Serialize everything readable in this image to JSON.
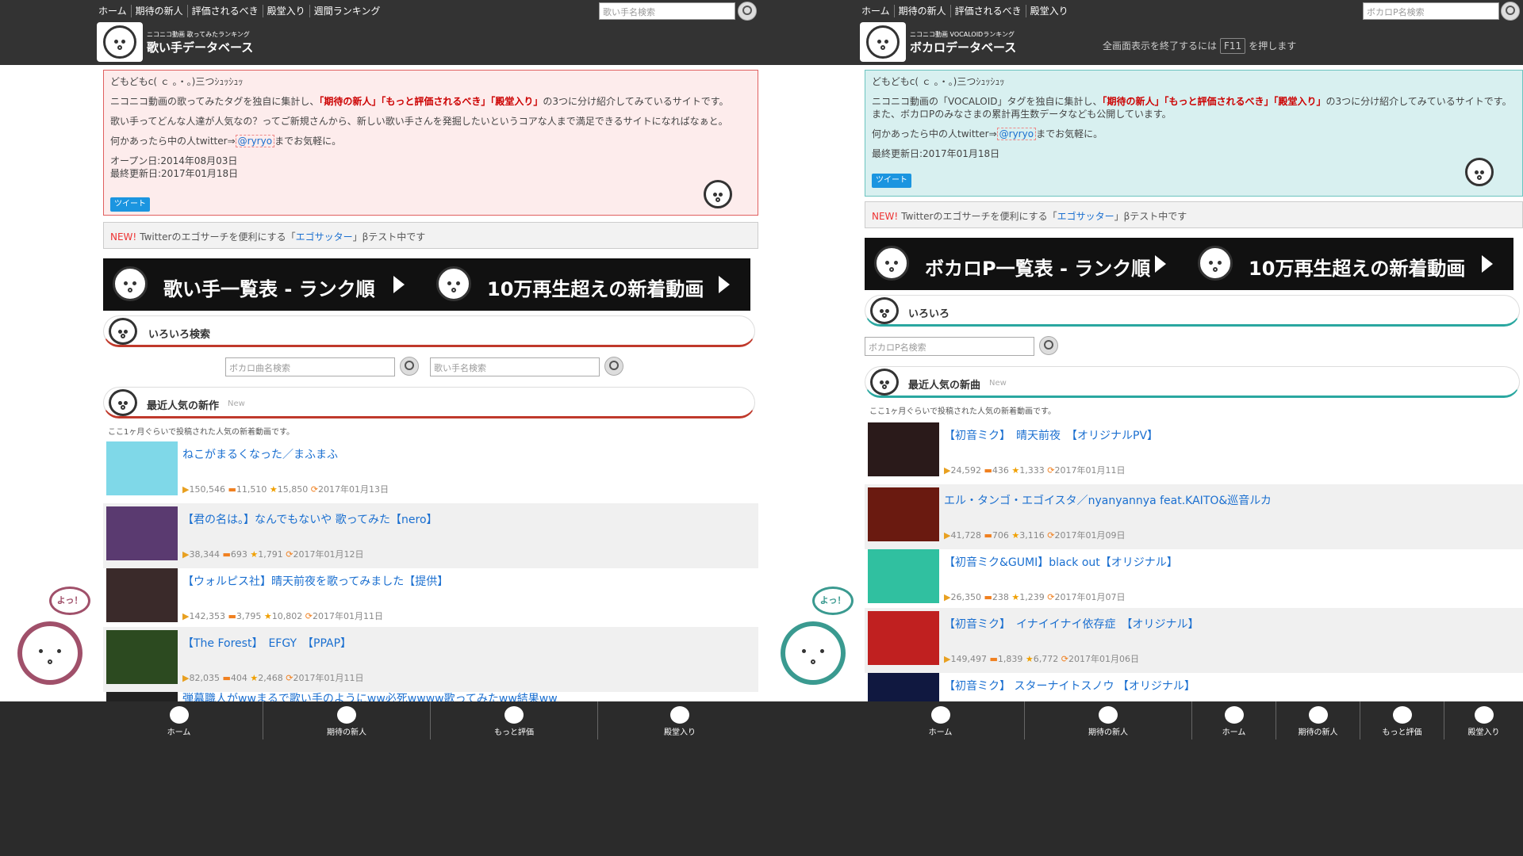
{
  "left": {
    "nav": [
      "ホーム",
      "期待の新人",
      "評価されるべき",
      "殿堂入り",
      "週間ランキング"
    ],
    "search_placeholder": "歌い手名検索",
    "logo_sub": "ニコニコ動画 歌ってみたランキング",
    "logo_title": "歌い手データベース",
    "intro": {
      "greeting": "どもどもc( ｃ ｡・。)三つｼｭｯｼｭｯ",
      "line1_pre": "ニコニコ動画の歌ってみたタグを独自に集計し、",
      "line1_hl": "「期待の新人」「もっと評価されるべき」「殿堂入り」",
      "line1_post": "の3つに分け紹介してみているサイトです。",
      "line2": "歌い手ってどんな人達が人気なの？ってご新規さんから、新しい歌い手さんを発掘したいというコアな人まで満足できるサイトになればなぁと。",
      "contact_pre": "何かあったら中の人twitter⇒",
      "contact_link": "@ryryo",
      "contact_post": "までお気軽に。",
      "open_date": "オープン日:2014年08月03日",
      "updated": "最終更新日:2017年01月18日",
      "tweet": "ツイート"
    },
    "newbar": {
      "new": "NEW!",
      "pre": "Twitterのエゴサーチを便利にする「",
      "link": "エゴサッター",
      "post": "」βテスト中です"
    },
    "banner": {
      "item1": "歌い手一覧表 - ランク順",
      "item2": "10万再生超えの新着動画"
    },
    "section_search": "いろいろ検索",
    "search1": "ボカロ曲名検索",
    "search2": "歌い手名検索",
    "section_recent": "最近人気の新作",
    "new_tag": "New",
    "note": "ここ1ヶ月ぐらいで投稿された人気の新着動画です。",
    "items": [
      {
        "title": "ねこがまるくなった／まふまふ",
        "views": "150,546",
        "comments": "11,510",
        "mylist": "15,850",
        "date": "2017年01月13日",
        "thumb": "#7fd8e8"
      },
      {
        "title": "【君の名は。】なんでもないや 歌ってみた【nero】",
        "views": "38,344",
        "comments": "693",
        "mylist": "1,791",
        "date": "2017年01月12日",
        "thumb": "#5a3a70"
      },
      {
        "title": "【ウォルピス社】晴天前夜を歌ってみました【提供】",
        "views": "142,353",
        "comments": "3,795",
        "mylist": "10,802",
        "date": "2017年01月11日",
        "thumb": "#3a2a2a"
      },
      {
        "title": "【The Forest】　EFGY　【PPAP】",
        "views": "82,035",
        "comments": "404",
        "mylist": "2,468",
        "date": "2017年01月11日",
        "thumb": "#2c4a20"
      },
      {
        "title": "弾幕職人がwwまるで歌い手のようにww必死wwww歌ってみたww結果ww",
        "views": "",
        "comments": "",
        "mylist": "",
        "date": "",
        "thumb": "#222"
      }
    ],
    "tabs": [
      "ホーム",
      "期待の新人",
      "もっと評価",
      "殿堂入り"
    ],
    "yo": "よっ！",
    "accent": "#c0392b",
    "mascot_color": "#a0506a"
  },
  "right": {
    "nav": [
      "ホーム",
      "期待の新人",
      "評価されるべき",
      "殿堂入り"
    ],
    "search_placeholder": "ボカロP名検索",
    "logo_sub": "ニコニコ動画 VOCALOIDランキング",
    "logo_title": "ボカロデータベース",
    "fs_pre": "全画面表示を終了するには",
    "fs_key": "F11",
    "fs_post": "を押します",
    "intro": {
      "greeting": "どもどもc( ｃ ｡・。)三つｼｭｯｼｭｯ",
      "line1_pre": "ニコニコ動画の「VOCALOID」タグを独自に集計し、",
      "line1_hl": "「期待の新人」「もっと評価されるべき」「殿堂入り」",
      "line1_post": "の3つに分け紹介してみているサイトです。また、ボカロPのみなさまの累計再生数データなども公開しています。",
      "contact_pre": "何かあったら中の人twitter⇒",
      "contact_link": "@ryryo",
      "contact_post": "までお気軽に。",
      "updated": "最終更新日:2017年01月18日",
      "tweet": "ツイート"
    },
    "newbar": {
      "new": "NEW!",
      "pre": "Twitterのエゴサーチを便利にする「",
      "link": "エゴサッター",
      "post": "」βテスト中です"
    },
    "banner": {
      "item1": "ボカロP一覧表 - ランク順",
      "item2": "10万再生超えの新着動画"
    },
    "section_misc": "いろいろ",
    "search1": "ボカロP名検索",
    "section_recent": "最近人気の新曲",
    "new_tag": "New",
    "note": "ここ1ヶ月ぐらいで投稿された人気の新着動画です。",
    "items": [
      {
        "title": "【初音ミク】　晴天前夜　【オリジナルPV】",
        "views": "24,592",
        "comments": "436",
        "mylist": "1,333",
        "date": "2017年01月11日",
        "thumb": "#2a1a1a"
      },
      {
        "title": "エル・タンゴ・エゴイスタ／nyanyannya feat.KAITO&巡音ルカ",
        "views": "41,728",
        "comments": "706",
        "mylist": "3,116",
        "date": "2017年01月09日",
        "thumb": "#6a1a10"
      },
      {
        "title": "【初音ミク&GUMI】black out【オリジナル】",
        "views": "26,350",
        "comments": "238",
        "mylist": "1,239",
        "date": "2017年01月07日",
        "thumb": "#30c0a0"
      },
      {
        "title": "【初音ミク】　イナイイナイ依存症　【オリジナル】",
        "views": "149,497",
        "comments": "1,839",
        "mylist": "6,772",
        "date": "2017年01月06日",
        "thumb": "#c02020"
      },
      {
        "title": "【初音ミク】 スターナイトスノウ 【オリジナル】",
        "views": "",
        "comments": "",
        "mylist": "",
        "date": "",
        "thumb": "#101840"
      }
    ],
    "tabs": [
      "ホーム",
      "期待の新人",
      "ホーム",
      "期待の新人",
      "もっと評価",
      "殿堂入り"
    ],
    "yo": "よっ！",
    "accent": "#2aa7a0",
    "mascot_color": "#3a9a90"
  }
}
